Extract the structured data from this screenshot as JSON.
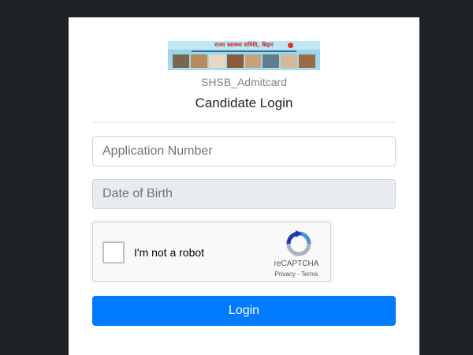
{
  "header": {
    "logo_text": "राज्य स्वास्थ्य समिति, बिहार",
    "site_name": "SHSB_Admitcard",
    "title": "Candidate Login"
  },
  "form": {
    "application_number": {
      "placeholder": "Application Number",
      "value": ""
    },
    "date_of_birth": {
      "placeholder": "Date of Birth",
      "value": ""
    },
    "recaptcha": {
      "label": "I'm not a robot",
      "brand": "reCAPTCHA",
      "terms": "Privacy - Terms",
      "checked": false
    },
    "login_label": "Login"
  },
  "colors": {
    "background": "#202326",
    "primary": "#007bff",
    "disabled_field": "#e9ecef"
  }
}
